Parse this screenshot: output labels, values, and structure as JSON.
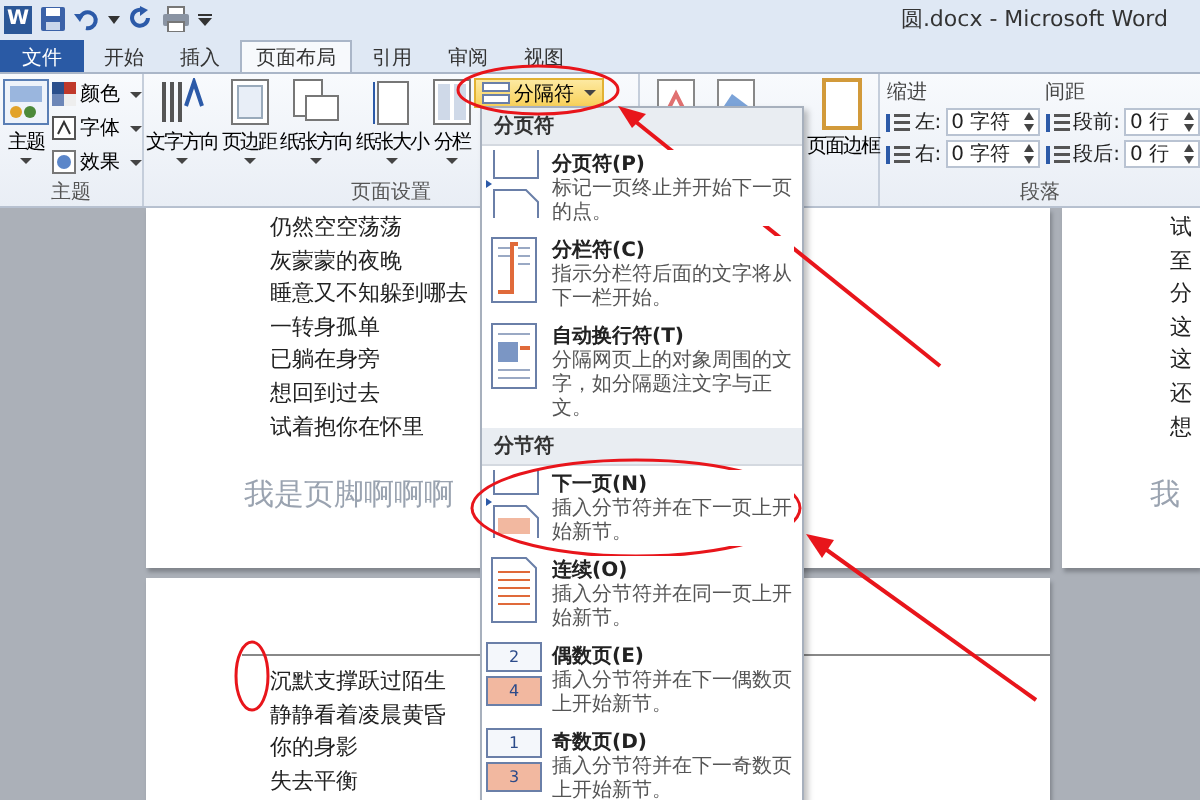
{
  "title_bar": {
    "app_letter": "W",
    "title": "圆.docx - Microsoft Word"
  },
  "tabs": [
    {
      "label": "文件",
      "kind": "file",
      "selected": false
    },
    {
      "label": "开始",
      "kind": "tab",
      "selected": false
    },
    {
      "label": "插入",
      "kind": "tab",
      "selected": false
    },
    {
      "label": "页面布局",
      "kind": "tab",
      "selected": true
    },
    {
      "label": "引用",
      "kind": "tab",
      "selected": false
    },
    {
      "label": "审阅",
      "kind": "tab",
      "selected": false
    },
    {
      "label": "视图",
      "kind": "tab",
      "selected": false
    }
  ],
  "theme_group": {
    "label": "主题",
    "big_button": "主题",
    "small_buttons": [
      "颜色",
      "字体",
      "效果"
    ]
  },
  "page_setup_group": {
    "label": "页面设置",
    "buttons": [
      "文字方向",
      "页边距",
      "纸张方向",
      "纸张大小",
      "分栏"
    ],
    "breaks_button": "分隔符"
  },
  "page_background_group": {
    "button": "页面边框"
  },
  "paragraph_group": {
    "label": "段落",
    "indent": {
      "label": "缩进",
      "fields": [
        {
          "label": "左:",
          "value": "0 字符"
        },
        {
          "label": "右:",
          "value": "0 字符"
        }
      ]
    },
    "spacing": {
      "label": "间距",
      "fields": [
        {
          "label": "段前:",
          "value": "0 行"
        },
        {
          "label": "段后:",
          "value": "0 行"
        }
      ]
    }
  },
  "breaks_menu": {
    "sections": [
      {
        "heading": "分页符",
        "items": [
          {
            "kind": "page_break",
            "title": "分页符(P)",
            "description": "标记一页终止并开始下一页的点。"
          },
          {
            "kind": "column",
            "title": "分栏符(C)",
            "description": "指示分栏符后面的文字将从下一栏开始。"
          },
          {
            "kind": "text_wrap",
            "title": "自动换行符(T)",
            "description": "分隔网页上的对象周围的文字，如分隔题注文字与正文。"
          }
        ]
      },
      {
        "heading": "分节符",
        "items": [
          {
            "kind": "next_page",
            "title": "下一页(N)",
            "description": "插入分节符并在下一页上开始新节。"
          },
          {
            "kind": "continuous",
            "title": "连续(O)",
            "description": "插入分节符并在同一页上开始新节。"
          },
          {
            "kind": "even_page",
            "title": "偶数页(E)",
            "description": "插入分节符并在下一偶数页上开始新节。",
            "icon_numbers": [
              "2",
              "4"
            ]
          },
          {
            "kind": "odd_page",
            "title": "奇数页(D)",
            "description": "插入分节符并在下一奇数页上开始新节。",
            "icon_numbers": [
              "1",
              "3"
            ]
          }
        ]
      }
    ]
  },
  "document": {
    "page_1": {
      "lines": [
        "仍然空空荡荡",
        "灰蒙蒙的夜晚",
        "睡意又不知躲到哪去",
        "一转身孤单",
        "已躺在身旁",
        "想回到过去",
        "试着抱你在怀里"
      ],
      "footer": "我是页脚啊啊啊"
    },
    "page_right": {
      "lines": [
        "试",
        "至",
        "分",
        "这",
        "这",
        "还",
        "想"
      ],
      "footer": "我"
    },
    "page_2": {
      "lines": [
        "沉默支撑跃过陌生",
        "静静看着凌晨黄昏",
        "你的身影",
        "失去平衡"
      ]
    }
  }
}
